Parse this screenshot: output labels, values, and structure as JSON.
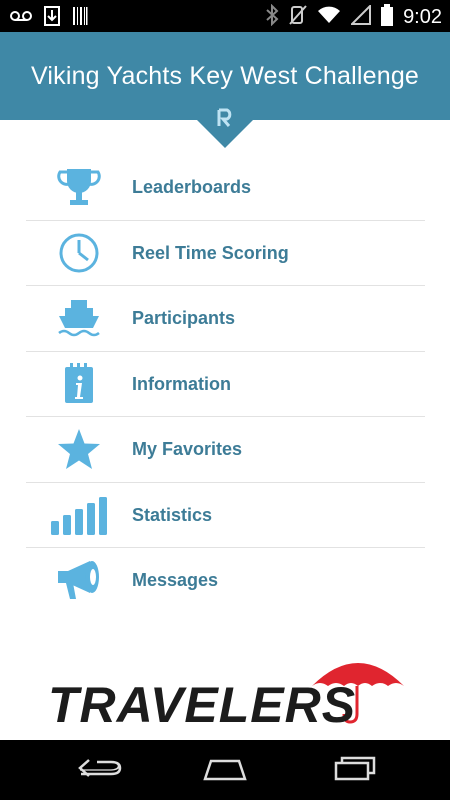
{
  "status_bar": {
    "time": "9:02",
    "left_icons": [
      "voicemail-icon",
      "download-icon",
      "barcode-icon"
    ],
    "right_icons": [
      "bluetooth-icon",
      "mute-icon",
      "wifi-icon",
      "signal-icon",
      "battery-icon"
    ]
  },
  "header": {
    "title": "Viking Yachts Key West Challenge",
    "background_color": "#3f88a6"
  },
  "menu": {
    "label_color": "#3d7c97",
    "icon_color": "#5bb3df",
    "items": [
      {
        "label": "Leaderboards",
        "icon": "trophy-icon"
      },
      {
        "label": "Reel Time Scoring",
        "icon": "clock-icon"
      },
      {
        "label": "Participants",
        "icon": "boat-icon"
      },
      {
        "label": "Information",
        "icon": "info-icon"
      },
      {
        "label": "My Favorites",
        "icon": "star-icon"
      },
      {
        "label": "Statistics",
        "icon": "bar-chart-icon"
      },
      {
        "label": "Messages",
        "icon": "megaphone-icon"
      }
    ]
  },
  "sponsor": {
    "name": "TRAVELERS",
    "logo_color": "#e0252f"
  },
  "nav_bar": {
    "buttons": [
      "back-icon",
      "home-icon",
      "recent-apps-icon"
    ]
  }
}
